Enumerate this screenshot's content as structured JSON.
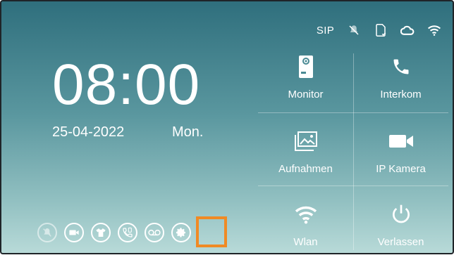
{
  "status": {
    "sip": "SIP",
    "icons": [
      "mute-icon",
      "sd-card-icon",
      "cloud-icon",
      "wifi-icon"
    ]
  },
  "clock": {
    "time": "08:00",
    "date": "25-04-2022",
    "day": "Mon."
  },
  "tiles": [
    {
      "label": "Monitor",
      "icon": "doorbell-station-icon"
    },
    {
      "label": "Interkom",
      "icon": "phone-icon"
    },
    {
      "label": "Aufnahmen",
      "icon": "gallery-icon"
    },
    {
      "label": "IP Kamera",
      "icon": "video-camera-icon"
    },
    {
      "label": "Wlan",
      "icon": "wifi-icon"
    },
    {
      "label": "Verlassen",
      "icon": "power-icon"
    }
  ],
  "quick_buttons": [
    "do-not-disturb-icon",
    "video-record-icon",
    "shirt-icon",
    "call-forward-icon",
    "voicemail-icon",
    "settings-icon"
  ],
  "colors": {
    "accent": "#f08a24",
    "text": "#ffffff"
  }
}
